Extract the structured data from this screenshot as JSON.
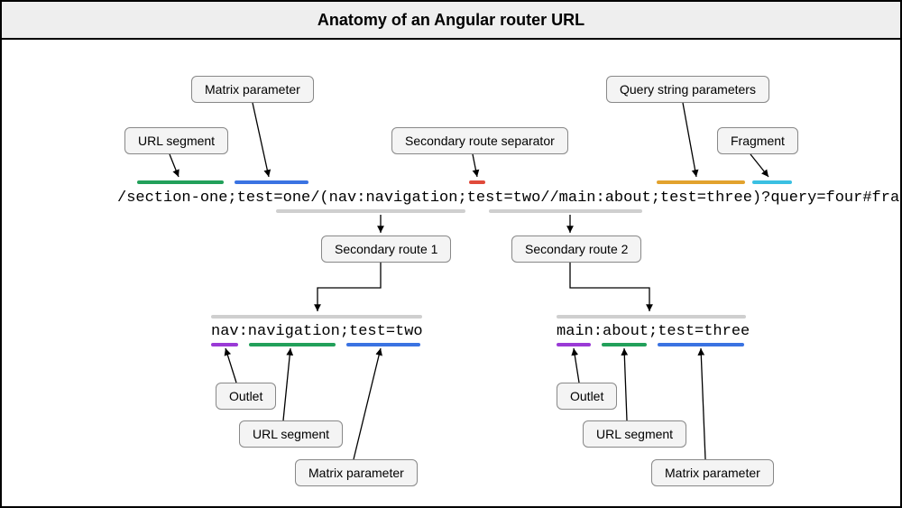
{
  "title": "Anatomy of an Angular router URL",
  "main_url": "/section-one;test=one/(nav:navigation;test=two//main:about;test=three)?query=four#frag",
  "sub1_url": "nav:navigation;test=two",
  "sub2_url": "main:about;test=three",
  "labels": {
    "matrix_parameter_top": "Matrix parameter",
    "url_segment_top": "URL segment",
    "secondary_route_separator": "Secondary route separator",
    "query_string_parameters": "Query string parameters",
    "fragment": "Fragment",
    "secondary_route_1": "Secondary route 1",
    "secondary_route_2": "Secondary route 2",
    "outlet1": "Outlet",
    "url_segment1": "URL segment",
    "matrix_parameter1": "Matrix parameter",
    "outlet2": "Outlet",
    "url_segment2": "URL segment",
    "matrix_parameter2": "Matrix parameter"
  },
  "colors": {
    "grey": "#cfcfcf",
    "green": "#22a05a",
    "blue": "#3a73e2",
    "red": "#e04a3a",
    "amber": "#e2a22e",
    "cyan": "#3ac0e2",
    "purple": "#9a3ad6"
  }
}
